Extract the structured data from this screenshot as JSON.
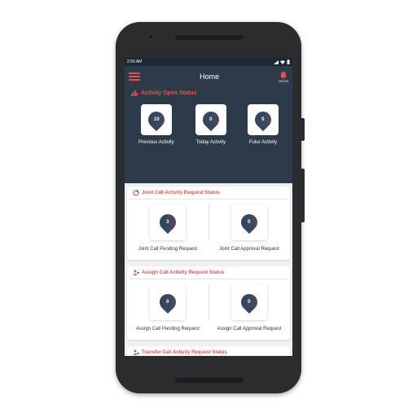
{
  "status_bar": {
    "time": "2:56 AM"
  },
  "header": {
    "title": "Home",
    "menu_icon": "hamburger-icon",
    "notification_icon": "bell-icon",
    "notification_label": "DOCR"
  },
  "open_status": {
    "title": "Activity Open Status",
    "icon": "bar-chart-icon",
    "items": [
      {
        "value": "10",
        "label": "Previous Activity"
      },
      {
        "value": "0",
        "label": "Today Activity"
      },
      {
        "value": "0",
        "label": "Futur Activity"
      }
    ]
  },
  "joint_call": {
    "title": "Joint Call Activity Request Status",
    "items": [
      {
        "value": "3",
        "label": "Joint Call Pending Request"
      },
      {
        "value": "0",
        "label": "Joint Call Approval Request"
      }
    ]
  },
  "assign_call": {
    "title": "Assign Call Activity Request Status",
    "items": [
      {
        "value": "0",
        "label": "Assign Call Pending Request"
      },
      {
        "value": "0",
        "label": "Assign Call Approval Request"
      }
    ]
  },
  "transfer_call": {
    "title": "Transfer Call Activity Request Status"
  },
  "colors": {
    "accent": "#e8534d",
    "header_bg": "#2d3a4a",
    "content_bg": "#eef0f2"
  }
}
